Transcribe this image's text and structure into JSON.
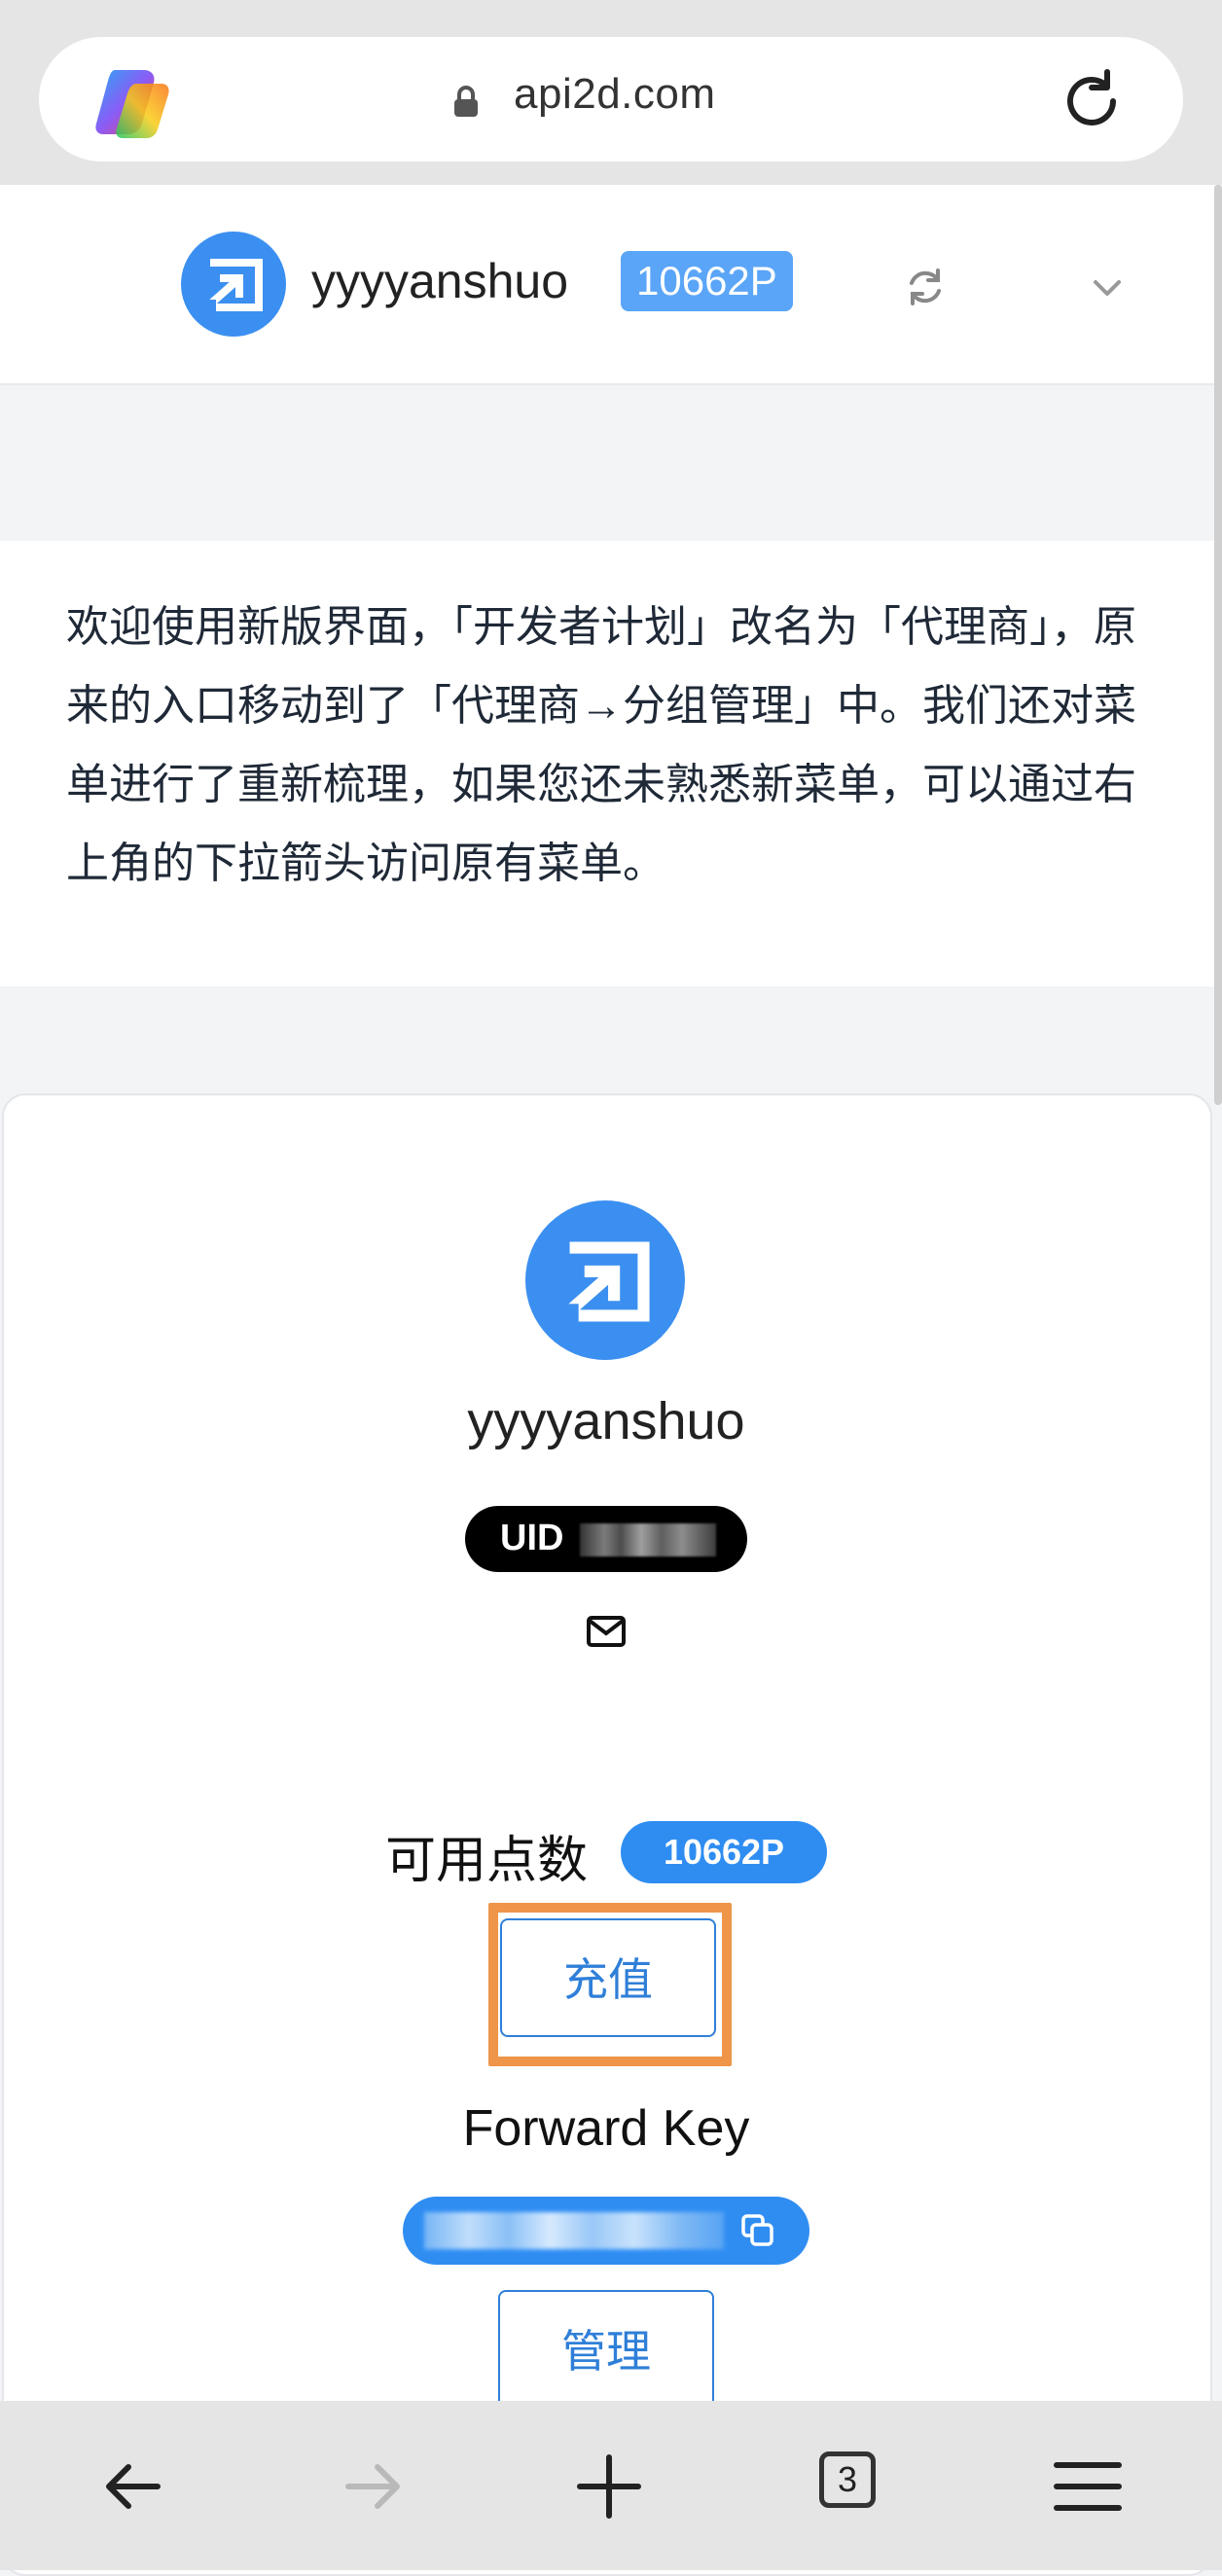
{
  "browser": {
    "url": "api2d.com",
    "tabs_count": "3"
  },
  "header": {
    "username": "yyyyanshuo",
    "points_badge": "10662P"
  },
  "notice": {
    "text": "欢迎使用新版界面，「开发者计划」改名为「代理商」，原来的入口移动到了「代理商→分组管理」中。我们还对菜单进行了重新梳理，如果您还未熟悉新菜单，可以通过右上角的下拉箭头访问原有菜单。"
  },
  "profile": {
    "username": "yyyyanshuo",
    "uid_label": "UID",
    "points_label": "可用点数",
    "points_value": "10662P",
    "recharge_label": "充值",
    "forward_key_label": "Forward Key",
    "manage_label": "管理"
  },
  "colors": {
    "accent": "#2f8df2",
    "highlight": "#ef9549"
  }
}
